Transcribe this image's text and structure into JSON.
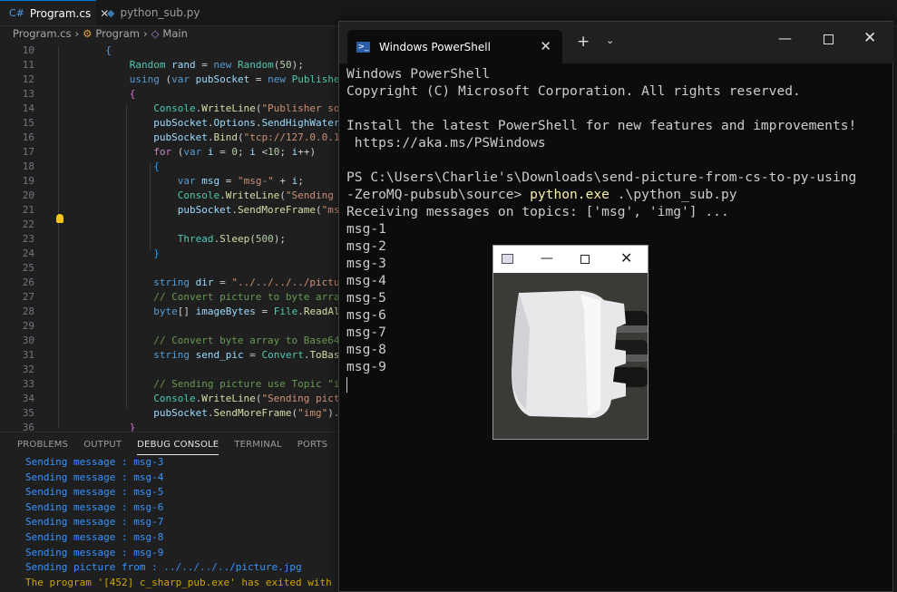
{
  "vscode": {
    "tabs": [
      {
        "label": "Program.cs",
        "active": true
      },
      {
        "label": "python_sub.py",
        "active": false
      }
    ],
    "breadcrumb": [
      "Program.cs",
      "Program",
      "Main"
    ],
    "line_numbers": [
      "10",
      "11",
      "12",
      "13",
      "14",
      "15",
      "16",
      "17",
      "18",
      "19",
      "20",
      "21",
      "22",
      "23",
      "24",
      "25",
      "26",
      "27",
      "28",
      "29",
      "30",
      "31",
      "32",
      "33",
      "34",
      "35",
      "36"
    ],
    "panel_tabs": [
      "PROBLEMS",
      "OUTPUT",
      "DEBUG CONSOLE",
      "TERMINAL",
      "PORTS"
    ],
    "console_lines": [
      "Sending message : msg-3",
      "Sending message : msg-4",
      "Sending message : msg-5",
      "Sending message : msg-6",
      "Sending message : msg-7",
      "Sending message : msg-8",
      "Sending message : msg-9",
      "Sending picture from : ../../../../picture.jpg",
      "The program '[452] c_sharp_pub.exe' has exited with co"
    ]
  },
  "powershell": {
    "window_title": "Windows PowerShell",
    "lines": [
      "Windows PowerShell",
      "Copyright (C) Microsoft Corporation. All rights reserved.",
      "",
      "Install the latest PowerShell for new features and improvements!",
      " https://aka.ms/PSWindows",
      "",
      "PS C:\\Users\\Charlie's\\Downloads\\send-picture-from-cs-to-py-using",
      "-ZeroMQ-pubsub\\source> "
    ],
    "command_exe": "python.exe",
    "command_arg": " .\\python_sub.py",
    "output": [
      "Receiving messages on topics: ['msg', 'img'] ...",
      "msg-1",
      "msg-2",
      "msg-3",
      "msg-4",
      "msg-5",
      "msg-6",
      "msg-7",
      "msg-8",
      "msg-9"
    ]
  },
  "colors": {
    "vscode_bg": "#1f1f1f",
    "console_text": "#3794ff",
    "console_warning": "#cca700",
    "powershell_bg": "#0c0c0c",
    "command_highlight": "#f9f1a5"
  },
  "icons": {
    "csharp_file": "csharp-file-icon",
    "python_file": "python-file-icon",
    "powershell": "powershell-icon",
    "lightbulb": "lightbulb-icon"
  }
}
